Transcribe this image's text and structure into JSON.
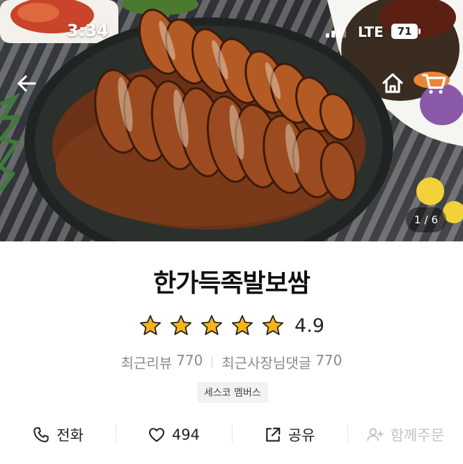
{
  "status_bar": {
    "time": "3:34",
    "network": "LTE",
    "battery": "71"
  },
  "hero": {
    "page_current": "1",
    "page_separator": "/",
    "page_total": "6"
  },
  "store": {
    "name": "한가득족발보쌈",
    "rating": "4.9",
    "star_count": 5,
    "star_color": "#F6B418",
    "recent_reviews_label": "최근리뷰",
    "recent_reviews_count": "770",
    "owner_comments_label": "최근사장님댓글",
    "owner_comments_count": "770",
    "tag": "세스코 멤버스"
  },
  "actions": {
    "call_label": "전화",
    "like_count": "494",
    "share_label": "공유",
    "group_order_label": "함께주문"
  },
  "icons": [
    "back-arrow-icon",
    "home-icon",
    "cart-icon",
    "star-icon",
    "phone-icon",
    "heart-icon",
    "share-icon",
    "add-person-icon"
  ]
}
